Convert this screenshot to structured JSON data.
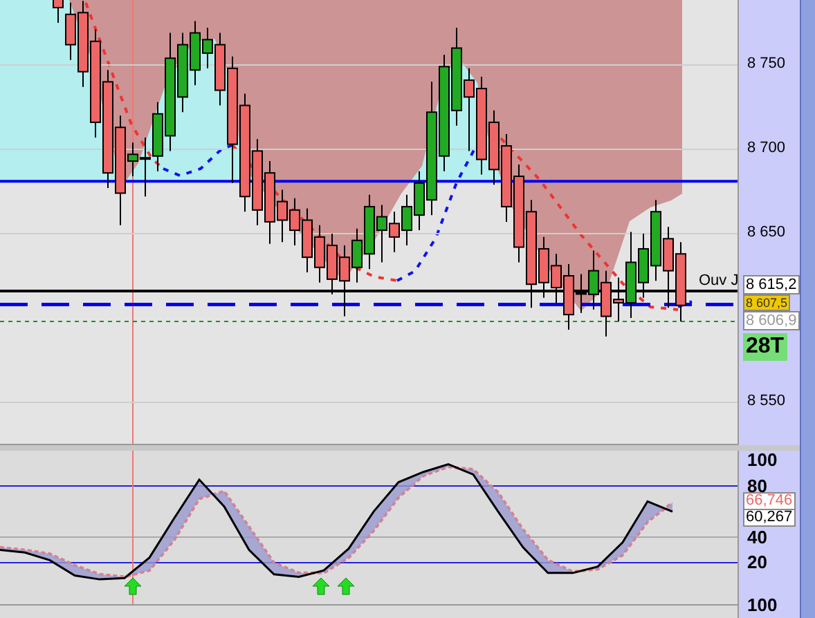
{
  "price_panel": {
    "chart_data": {
      "type": "candlestick",
      "ylim": [
        8524.6,
        8788.5
      ],
      "grid": true,
      "ref_lines": [
        {
          "axis": "y",
          "value": 8681,
          "color": "#0000ee",
          "line_style": "solid"
        },
        {
          "axis": "y",
          "value": 8616,
          "color": "#000000",
          "line_style": "solid"
        },
        {
          "axis": "y",
          "value": 8608,
          "color": "#0000ee",
          "line_style": "dashed"
        },
        {
          "axis": "y",
          "value": 8598,
          "color": "#119911",
          "line_style": "dotted"
        }
      ],
      "yticks": [
        {
          "value": 8750,
          "label": "8 750"
        },
        {
          "value": 8700,
          "label": "8 700"
        },
        {
          "value": 8650,
          "label": "8 650"
        },
        {
          "value": 8550,
          "label": "8 550"
        }
      ],
      "ohlc": [
        [
          8789,
          8796,
          8775,
          8784
        ],
        [
          8780,
          8787,
          8753,
          8762
        ],
        [
          8781,
          8788,
          8737,
          8746
        ],
        [
          8764,
          8771,
          8707,
          8716
        ],
        [
          8740,
          8747,
          8677,
          8686
        ],
        [
          8713,
          8720,
          8655,
          8674
        ],
        [
          8693,
          8704,
          8684,
          8697
        ],
        [
          8695,
          8707,
          8672,
          8695
        ],
        [
          8696,
          8728,
          8687,
          8721
        ],
        [
          8708,
          8769,
          8699,
          8754
        ],
        [
          8731,
          8769,
          8722,
          8762
        ],
        [
          8747,
          8776,
          8738,
          8769
        ],
        [
          8757,
          8772,
          8748,
          8765
        ],
        [
          8762,
          8769,
          8726,
          8735
        ],
        [
          8748,
          8755,
          8680,
          8703
        ],
        [
          8726,
          8733,
          8663,
          8672
        ],
        [
          8699,
          8706,
          8655,
          8664
        ],
        [
          8686,
          8693,
          8644,
          8657
        ],
        [
          8669,
          8676,
          8645,
          8658
        ],
        [
          8664,
          8671,
          8643,
          8652
        ],
        [
          8658,
          8665,
          8627,
          8636
        ],
        [
          8648,
          8655,
          8621,
          8630
        ],
        [
          8643,
          8650,
          8614,
          8623
        ],
        [
          8636,
          8643,
          8601,
          8622
        ],
        [
          8630,
          8653,
          8621,
          8646
        ],
        [
          8638,
          8673,
          8629,
          8666
        ],
        [
          8652,
          8667,
          8633,
          8660
        ],
        [
          8656,
          8663,
          8639,
          8648
        ],
        [
          8652,
          8673,
          8643,
          8666
        ],
        [
          8661,
          8687,
          8652,
          8680
        ],
        [
          8670,
          8740,
          8661,
          8722
        ],
        [
          8696,
          8756,
          8687,
          8749
        ],
        [
          8723,
          8772,
          8714,
          8760
        ],
        [
          8741,
          8748,
          8699,
          8731
        ],
        [
          8736,
          8743,
          8685,
          8694
        ],
        [
          8716,
          8723,
          8679,
          8688
        ],
        [
          8702,
          8709,
          8657,
          8666
        ],
        [
          8684,
          8691,
          8633,
          8642
        ],
        [
          8663,
          8670,
          8606,
          8620
        ],
        [
          8641,
          8648,
          8612,
          8621
        ],
        [
          8631,
          8638,
          8609,
          8618
        ],
        [
          8625,
          8632,
          8593,
          8602
        ],
        [
          8615,
          8626,
          8603,
          8615
        ],
        [
          8614,
          8640,
          8605,
          8628
        ],
        [
          8621,
          8628,
          8589,
          8601
        ],
        [
          8611,
          8624,
          8598,
          8609
        ],
        [
          8609,
          8651,
          8600,
          8633
        ],
        [
          8621,
          8650,
          8612,
          8641
        ],
        [
          8631,
          8670,
          8622,
          8663
        ],
        [
          8647,
          8654,
          8606,
          8628
        ],
        [
          8638,
          8645,
          8598,
          8607.5
        ]
      ]
    },
    "level_label": "Ouv J",
    "price_tags": [
      {
        "text": "8 615,2",
        "kind": "close"
      },
      {
        "text": "8 607,5",
        "kind": "open"
      },
      {
        "text": "8 606,9",
        "kind": "level"
      }
    ],
    "timeframe_badge": "28T"
  },
  "oscillator_panel": {
    "chart_data": {
      "type": "line",
      "ylim": [
        -12.4,
        107.6
      ],
      "ref_lines": [
        {
          "axis": "y",
          "value": 80,
          "color": "#2222dd",
          "line_style": "solid"
        },
        {
          "axis": "y",
          "value": 20,
          "color": "#2222dd",
          "line_style": "solid"
        },
        {
          "axis": "y",
          "value": 40,
          "color": "#aaaaaa",
          "line_style": "solid"
        }
      ],
      "yticks": [
        {
          "value": 100,
          "label": "100"
        },
        {
          "value": 80,
          "label": "80"
        },
        {
          "value": 40,
          "label": "40"
        },
        {
          "value": 20,
          "label": "20"
        }
      ],
      "series": [
        {
          "color": "#000000",
          "line_style": "solid",
          "values": [
            30,
            28,
            22,
            10,
            7,
            8,
            24,
            55,
            85,
            64,
            30,
            11,
            9,
            14,
            31,
            60,
            83,
            91,
            97,
            89,
            60,
            32,
            12,
            12,
            17,
            36,
            68,
            60
          ]
        },
        {
          "color": "#ee7777",
          "line_style": "dashed",
          "values": [
            32,
            30,
            27,
            18,
            11,
            9,
            14,
            38,
            70,
            76,
            48,
            20,
            12,
            12,
            24,
            45,
            71,
            88,
            95,
            93,
            75,
            46,
            22,
            13,
            15,
            26,
            52,
            67
          ]
        }
      ]
    },
    "value_tags": [
      {
        "text": "66,746",
        "kind": "signal"
      },
      {
        "text": "60,267",
        "kind": "main"
      }
    ]
  },
  "next_panel": {
    "axis_label": "100"
  }
}
